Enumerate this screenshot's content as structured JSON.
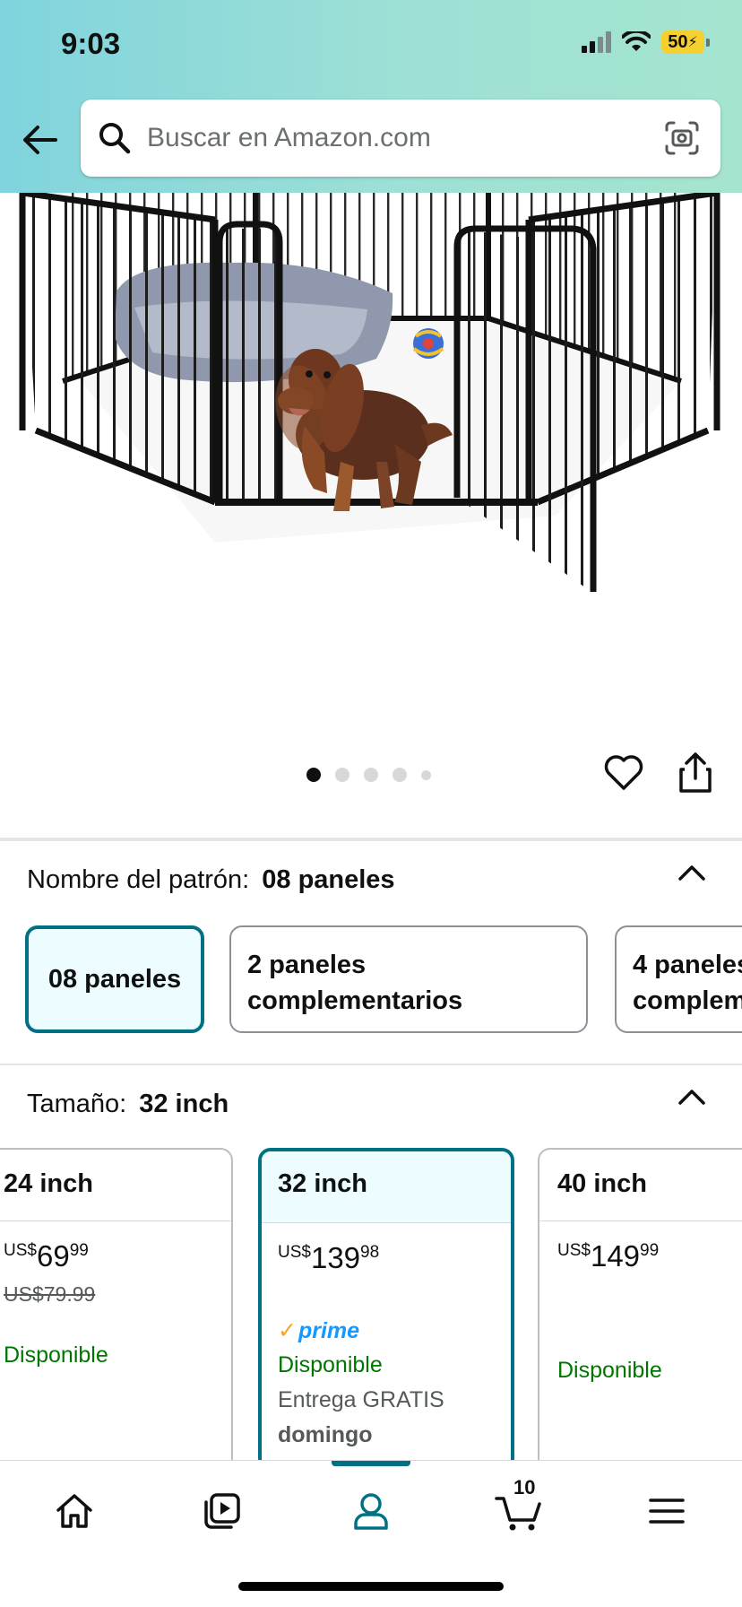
{
  "status_bar": {
    "time": "9:03",
    "battery": "50"
  },
  "search": {
    "placeholder": "Buscar en Amazon.com"
  },
  "carousel": {
    "total_images": 5,
    "current_index": 1
  },
  "pattern": {
    "label": "Nombre del patrón:",
    "selected": "08 paneles",
    "options": [
      {
        "line1": "08 paneles",
        "line2": ""
      },
      {
        "line1": "2 paneles",
        "line2": "complementarios"
      },
      {
        "line1": "4 paneles",
        "line2": "complem"
      }
    ]
  },
  "size": {
    "label": "Tamaño:",
    "selected": "32 inch",
    "options": [
      {
        "name": "24 inch",
        "currency": "US$",
        "whole": "69",
        "fraction": "99",
        "list_price": "US$79.99",
        "availability": "Disponible"
      },
      {
        "name": "32 inch",
        "currency": "US$",
        "whole": "139",
        "fraction": "98",
        "prime": "prime",
        "availability": "Disponible",
        "delivery": "Entrega GRATIS",
        "delivery_day": "domingo"
      },
      {
        "name": "40 inch",
        "currency": "US$",
        "whole": "149",
        "fraction": "99",
        "availability": "Disponible"
      }
    ]
  },
  "bottom_nav": {
    "items": [
      "home-icon",
      "video-icon",
      "account-icon",
      "cart-icon",
      "menu-icon"
    ],
    "active": "account-icon",
    "cart_count": "10"
  },
  "colors": {
    "accent": "#007185",
    "available": "#007600",
    "prime": "#1399ff",
    "header_start": "#80d4dd",
    "header_end": "#a5e4cf"
  }
}
